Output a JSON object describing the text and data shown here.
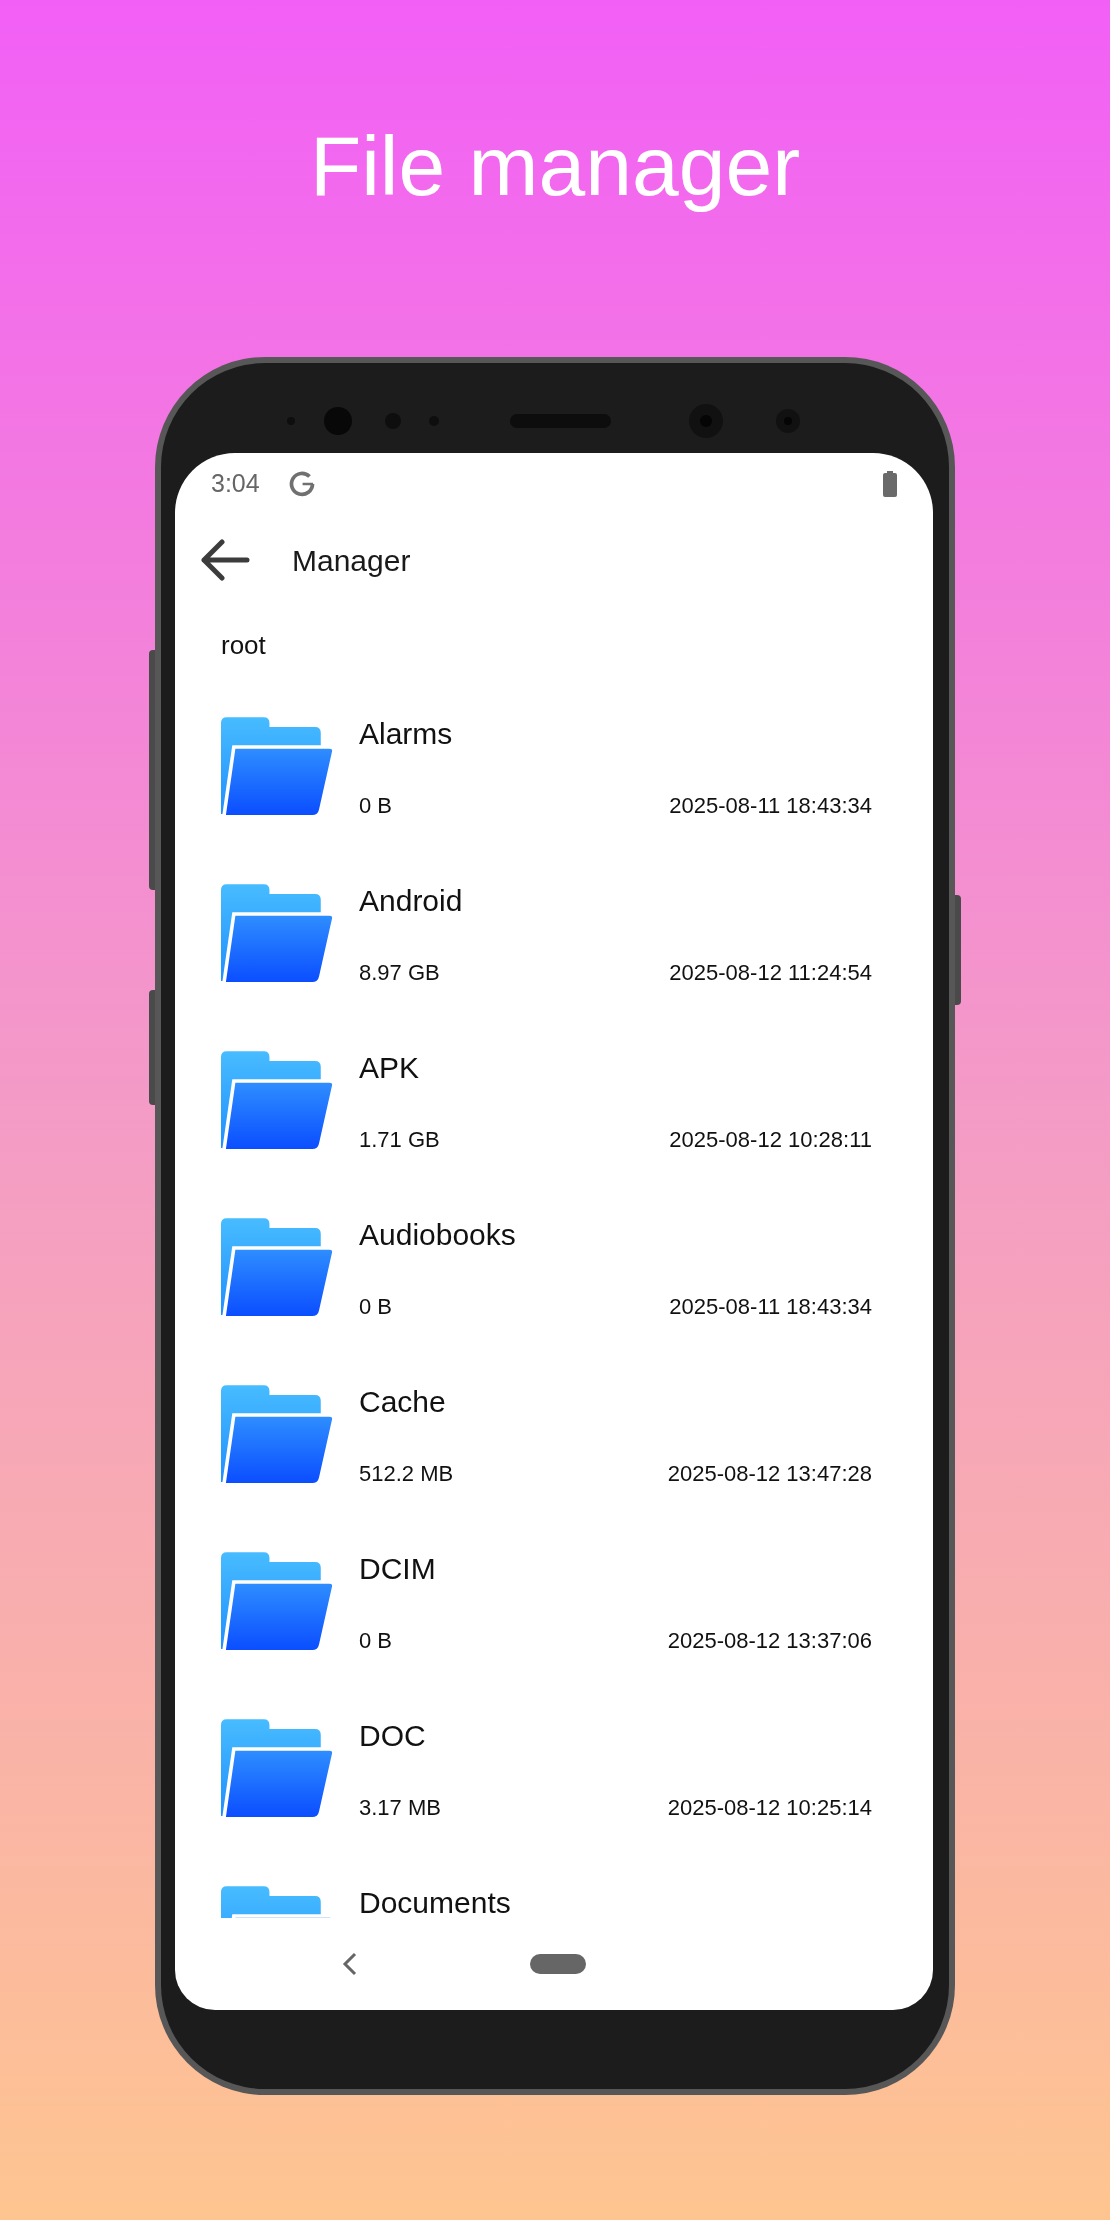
{
  "header": {
    "title": "File manager"
  },
  "status_bar": {
    "time": "3:04"
  },
  "app_bar": {
    "title": "Manager"
  },
  "path": "root",
  "files": [
    {
      "name": "Alarms",
      "size": "0 B",
      "modified": "2025-08-11 18:43:34"
    },
    {
      "name": "Android",
      "size": "8.97 GB",
      "modified": "2025-08-12 11:24:54"
    },
    {
      "name": "APK",
      "size": "1.71 GB",
      "modified": "2025-08-12 10:28:11"
    },
    {
      "name": "Audiobooks",
      "size": "0 B",
      "modified": "2025-08-11 18:43:34"
    },
    {
      "name": "Cache",
      "size": "512.2 MB",
      "modified": "2025-08-12 13:47:28"
    },
    {
      "name": "DCIM",
      "size": "0 B",
      "modified": "2025-08-12 13:37:06"
    },
    {
      "name": "DOC",
      "size": "3.17 MB",
      "modified": "2025-08-12 10:25:14"
    },
    {
      "name": "Documents"
    }
  ]
}
